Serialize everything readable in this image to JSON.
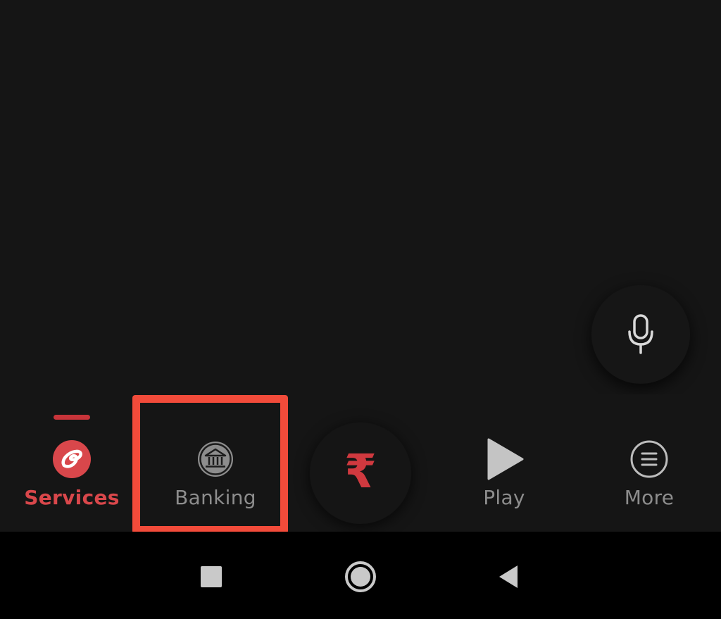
{
  "colors": {
    "background": "#151515",
    "accent_red": "#d9474b",
    "inactive_gray": "#8d8d8d",
    "highlight_box": "#f24b3a",
    "system_bar": "#000000"
  },
  "bottom_nav": {
    "items": [
      {
        "label": "Services",
        "icon": "airtel-logo-icon",
        "active": true
      },
      {
        "label": "Banking",
        "icon": "bank-icon",
        "active": false
      },
      {
        "label": "",
        "icon": "rupee-icon",
        "active": false
      },
      {
        "label": "Play",
        "icon": "play-icon",
        "active": false
      },
      {
        "label": "More",
        "icon": "menu-circle-icon",
        "active": false
      }
    ],
    "pay_symbol": "₹"
  },
  "fab": {
    "icon": "microphone-icon"
  },
  "system_nav": {
    "buttons": [
      "recents-icon",
      "home-icon",
      "back-icon"
    ]
  }
}
